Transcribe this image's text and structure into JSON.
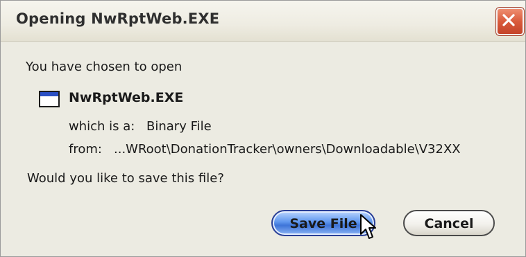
{
  "dialog": {
    "title": "Opening NwRptWeb.EXE",
    "close_icon": "close-icon",
    "intro": "You have chosen to open",
    "file_icon": "application-window-icon",
    "file_name": "NwRptWeb.EXE",
    "which_label": "which is a:",
    "which_value": "Binary File",
    "from_label": "from:",
    "from_value": "...WRoot\\DonationTracker\\owners\\Downloadable\\V32XX",
    "question": "Would you like to save this file?",
    "save_label": "Save File",
    "cancel_label": "Cancel",
    "colors": {
      "close_button": "#d95b3c",
      "save_button": "#4a80e0",
      "background": "#ecebe2"
    }
  }
}
